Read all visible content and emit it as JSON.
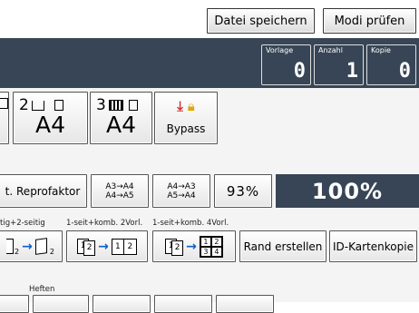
{
  "toolbar": {
    "save_file_label": "Datei speichern",
    "check_modes_label": "Modi prüfen"
  },
  "counters": [
    {
      "label": "Vorlage",
      "value": "0"
    },
    {
      "label": "Anzahl",
      "value": "1"
    },
    {
      "label": "Kopie",
      "value": "0"
    }
  ],
  "paper_trays": [
    {
      "tray": "2",
      "size": "A4"
    },
    {
      "tray": "3",
      "size": "A4"
    }
  ],
  "bypass": {
    "label": "Bypass"
  },
  "ratio_row": {
    "reprofactor_label": "t. Reprofaktor",
    "preset1_line1": "A3→A4",
    "preset1_line2": "A4→A5",
    "preset2_line1": "A4→A3",
    "preset2_line2": "A5→A4",
    "current_percent": "93%",
    "full_percent": "100%"
  },
  "duplex": {
    "label_left": "tig+2-seitig",
    "label_combine2": "1-seit+komb. 2Vorl.",
    "label_combine4": "1-seit+komb. 4Vorl.",
    "combine2_from": "1",
    "combine2_from2": "2",
    "combine2_to1": "1",
    "combine2_to2": "2",
    "combine4_from": "1",
    "combine4_from2": "2",
    "combine4_to": [
      "1",
      "2",
      "3",
      "4"
    ],
    "dup_sub": "2",
    "margin_label": "Rand erstellen",
    "id_card_label": "ID-Kartenkopie"
  },
  "staple": {
    "label": "Heften"
  },
  "colors": {
    "header": "#374556",
    "accent_arrow": "#0f5ec9",
    "bypass_icon": "#d32f2f",
    "lock_icon": "#e0a800"
  }
}
